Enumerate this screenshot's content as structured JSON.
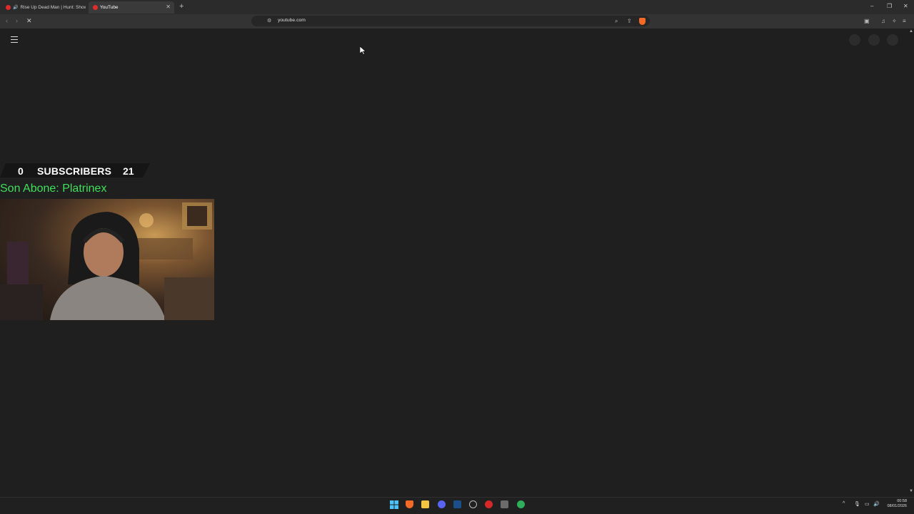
{
  "browser": {
    "tabs": [
      {
        "title": "Rise Up Dead Man | Hunt: Show"
      },
      {
        "title": "YouTube"
      }
    ],
    "address": "youtube.com"
  },
  "overlay": {
    "subs_current": "0",
    "subs_label": "SUBSCRIBERS",
    "subs_goal": "21",
    "last_sub": "Son Abone: Platrinex"
  },
  "taskbar": {
    "time": "00:58",
    "date": "08/01/2026"
  },
  "colors": {
    "accent_green": "#3fe05a",
    "background": "#1f1f1f"
  }
}
